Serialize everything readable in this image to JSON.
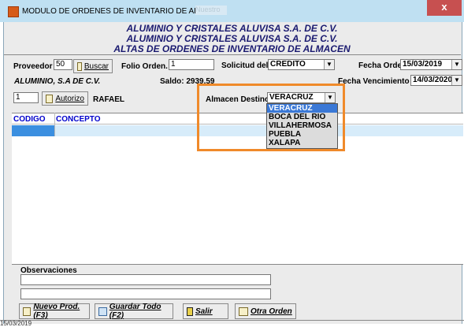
{
  "window": {
    "title": "MODULO DE ORDENES DE INVENTARIO DE ALMACEN",
    "title_suffix": "Nuestro",
    "close_label": "x"
  },
  "header": {
    "line1": "ALUMINIO Y CRISTALES ALUVISA S.A. DE C.V.",
    "line2": "ALUMINIO Y CRISTALES ALUVISA S.A. DE C.V.",
    "line3": "ALTAS DE ORDENES DE INVENTARIO DE ALMACEN"
  },
  "form": {
    "proveedor_label": "Proveedor",
    "proveedor_value": "50",
    "buscar_label": "Buscar",
    "folio_label": "Folio Orden.",
    "folio_value": "1",
    "solicitud_label": "Solicitud del:",
    "solicitud_value": "CREDITO",
    "fecha_orden_label": "Fecha Orden",
    "fecha_orden_value": "15/03/2019",
    "proveedor_name": "ALUMINIO, S.A DE C.V.",
    "saldo_label": "Saldo: 2939.59",
    "fecha_venc_label": "Fecha Vencimiento",
    "fecha_venc_value": "14/03/2020",
    "autorizo_value": "1",
    "autorizo_label": "Autorizo",
    "autorizo_name": "RAFAEL",
    "almacen_label": "Almacen Destino",
    "almacen_value": "VERACRUZ",
    "almacen_options": [
      "VERACRUZ",
      "BOCA DEL RIO",
      "VILLAHERMOSA",
      "PUEBLA",
      "XALAPA"
    ]
  },
  "grid": {
    "col_codigo": "CODIGO",
    "col_concepto": "CONCEPTO"
  },
  "footer": {
    "observaciones_label": "Observaciones",
    "nuevo_label": "Nuevo Prod. (F3)",
    "guardar_label": "Guardar Todo  (F2)",
    "salir_label": "Salir",
    "otra_label": "Otra Orden",
    "status_date": "15/03/2019"
  },
  "colors": {
    "highlight": "#f08a2a",
    "selection": "#3a78d6",
    "header_text": "#1a1a70"
  }
}
